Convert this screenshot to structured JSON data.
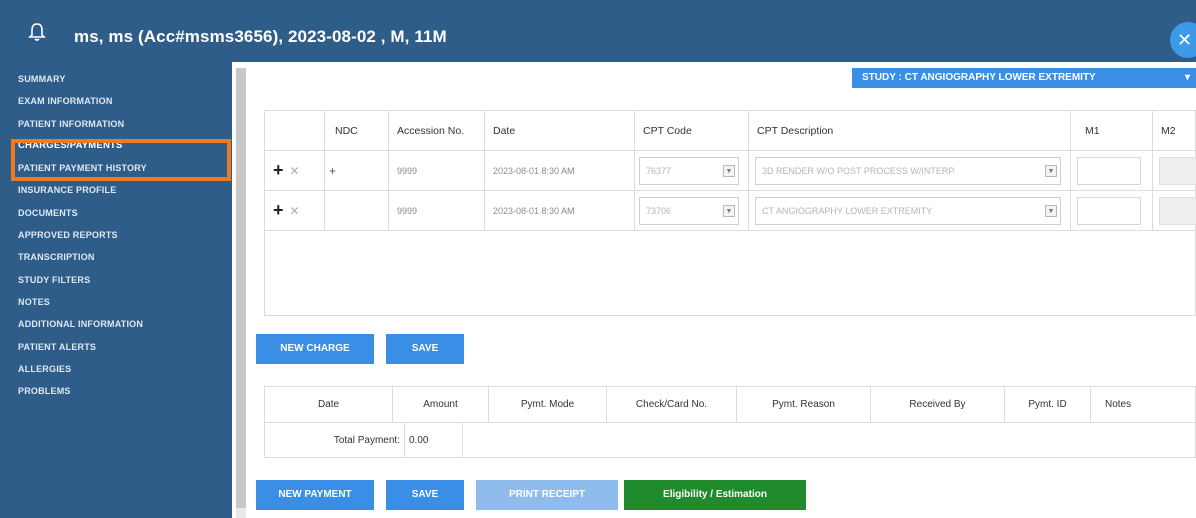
{
  "header": {
    "title": "ms, ms (Acc#msms3656), 2023-08-02 , M, 11M",
    "bell_icon": "bell-icon",
    "close_icon": "close-icon"
  },
  "sidebar": {
    "items": [
      {
        "label": "SUMMARY"
      },
      {
        "label": "EXAM INFORMATION"
      },
      {
        "label": "PATIENT INFORMATION"
      },
      {
        "label": "CHARGES/PAYMENTS",
        "active": true
      },
      {
        "label": "PATIENT PAYMENT HISTORY"
      },
      {
        "label": "INSURANCE PROFILE"
      },
      {
        "label": "DOCUMENTS"
      },
      {
        "label": "APPROVED REPORTS"
      },
      {
        "label": "TRANSCRIPTION"
      },
      {
        "label": "STUDY FILTERS"
      },
      {
        "label": "NOTES"
      },
      {
        "label": "ADDITIONAL INFORMATION"
      },
      {
        "label": "PATIENT ALERTS"
      },
      {
        "label": "ALLERGIES"
      },
      {
        "label": "PROBLEMS"
      }
    ],
    "highlight_color": "#f07a22"
  },
  "study": {
    "label": "STUDY : CT ANGIOGRAPHY LOWER EXTREMITY",
    "caret": "▾"
  },
  "charges": {
    "columns": [
      "NDC",
      "Accession No.",
      "Date",
      "CPT Code",
      "CPT Description",
      "M1",
      "M2"
    ],
    "rows": [
      {
        "plus": "+",
        "remove": "✕",
        "ndc": "+",
        "accession": "9999",
        "date": "2023-08-01 8:30 AM",
        "cpt_code": "76377",
        "cpt_description": "3D RENDER W/O POST PROCESS W/INTERP",
        "m1": ""
      },
      {
        "plus": "+",
        "remove": "✕",
        "ndc": "",
        "accession": "9999",
        "date": "2023-08-01 8:30 AM",
        "cpt_code": "73706",
        "cpt_description": "CT ANGIOGRAPHY LOWER EXTREMITY",
        "m1": ""
      }
    ]
  },
  "buttons": {
    "new_charge": "NEW CHARGE",
    "save_charge": "SAVE",
    "new_payment": "NEW PAYMENT",
    "save_payment": "SAVE",
    "print_receipt": "PRINT RECEIPT",
    "eligibility": "Eligibility / Estimation"
  },
  "payments": {
    "columns": [
      "Date",
      "Amount",
      "Pymt. Mode",
      "Check/Card No.",
      "Pymt. Reason",
      "Received By",
      "Pymt. ID",
      "Notes"
    ],
    "total_label": "Total Payment:",
    "total_value": "0.00"
  },
  "colors": {
    "header_bg": "#2f5d89",
    "accent_blue": "#3a8ee6",
    "eligibility_green": "#1f8b2c"
  }
}
